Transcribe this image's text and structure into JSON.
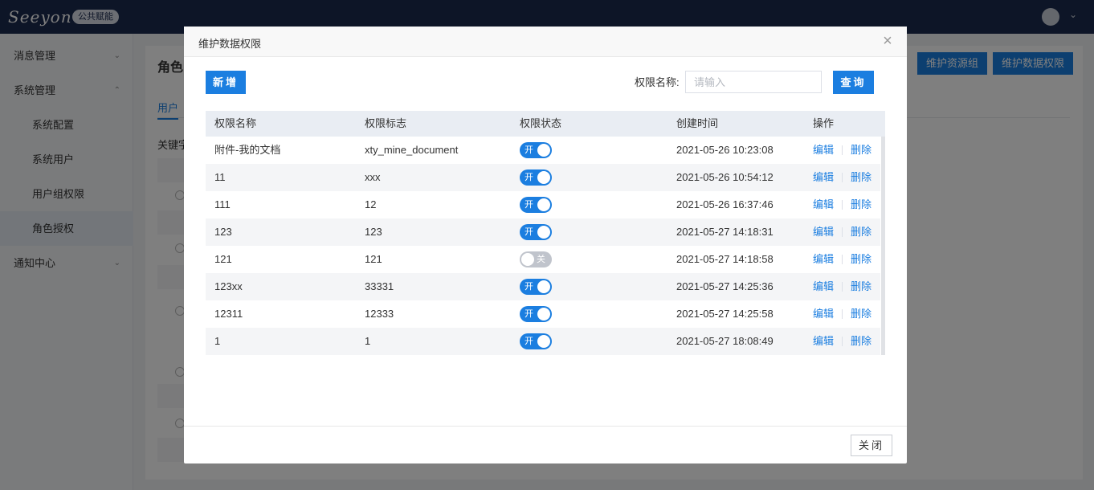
{
  "app": {
    "logo_text": "Seeyon",
    "logo_badge": "公共赋能"
  },
  "sidebar": {
    "items": [
      {
        "label": "消息管理",
        "caret": "⌄"
      },
      {
        "label": "系统管理",
        "caret": "⌃"
      },
      {
        "label": "系统配置"
      },
      {
        "label": "系统用户"
      },
      {
        "label": "用户组权限"
      },
      {
        "label": "角色授权"
      },
      {
        "label": "通知中心",
        "caret": "⌄"
      }
    ]
  },
  "main": {
    "title": "角色",
    "tab_user": "用户",
    "keyword_label": "关键字",
    "btn_resource_group": "维护资源组",
    "btn_data_permission": "维护数据权限"
  },
  "modal": {
    "title": "维护数据权限",
    "close_icon": "×",
    "add_button": "新增",
    "search_label": "权限名称:",
    "search_placeholder": "请输入",
    "search_value": "",
    "query_button": "查询",
    "close_button": "关闭"
  },
  "table": {
    "headers": [
      "权限名称",
      "权限标志",
      "权限状态",
      "创建时间",
      "操作"
    ],
    "edit_label": "编辑",
    "delete_label": "删除",
    "on_text": "开",
    "off_text": "关",
    "rows": [
      {
        "name": "附件-我的文档",
        "flag": "xty_mine_document",
        "enabled": true,
        "created": "2021-05-26 10:23:08"
      },
      {
        "name": "11",
        "flag": "xxx",
        "enabled": true,
        "created": "2021-05-26 10:54:12"
      },
      {
        "name": "111",
        "flag": "12",
        "enabled": true,
        "created": "2021-05-26 16:37:46"
      },
      {
        "name": "123",
        "flag": "123",
        "enabled": true,
        "created": "2021-05-27 14:18:31"
      },
      {
        "name": "121",
        "flag": "121",
        "enabled": false,
        "created": "2021-05-27 14:18:58"
      },
      {
        "name": "123xx",
        "flag": "33331",
        "enabled": true,
        "created": "2021-05-27 14:25:36"
      },
      {
        "name": "12311",
        "flag": "12333",
        "enabled": true,
        "created": "2021-05-27 14:25:58"
      },
      {
        "name": "1",
        "flag": "1",
        "enabled": true,
        "created": "2021-05-27 18:08:49"
      }
    ]
  },
  "colors": {
    "primary": "#1b7ee0",
    "topbar": "#1b2a4e",
    "switch_off": "#c0c4cc"
  }
}
